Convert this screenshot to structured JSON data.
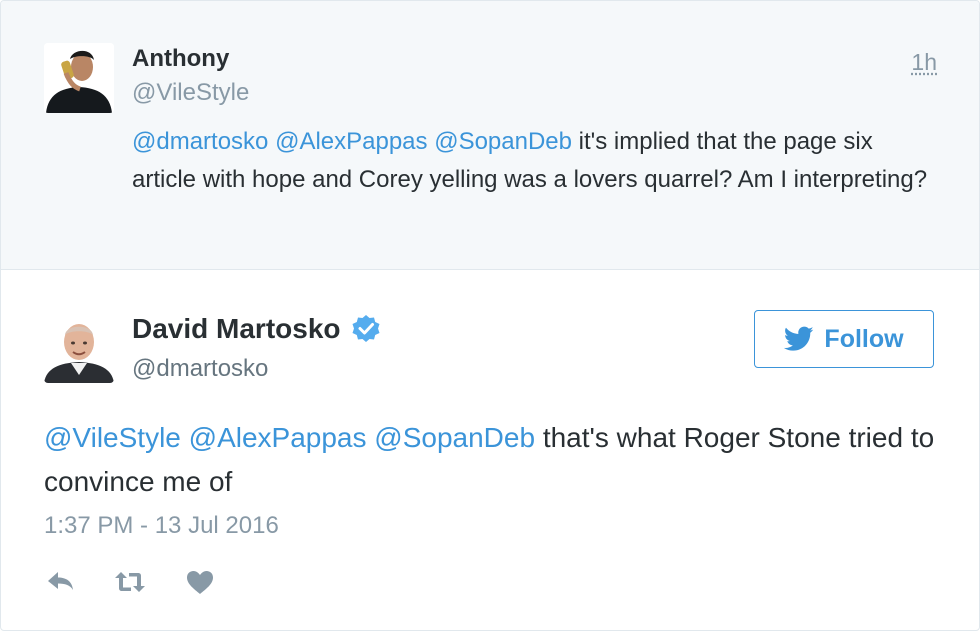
{
  "parent_tweet": {
    "author_name": "Anthony",
    "author_handle": "@VileStyle",
    "relative_time": "1h",
    "mentions": [
      "@dmartosko",
      "@AlexPappas",
      "@SopanDeb"
    ],
    "body_text": "it's implied that the page six article with hope and Corey yelling was a lovers quarrel? Am I interpreting?"
  },
  "tweet": {
    "author_name": "David Martosko",
    "author_handle": "@dmartosko",
    "verified": true,
    "follow_label": "Follow",
    "mentions": [
      "@VileStyle",
      "@AlexPappas",
      "@SopanDeb"
    ],
    "body_text": "that's what Roger Stone tried to convince me of",
    "timestamp": "1:37 PM - 13 Jul 2016",
    "actions": [
      "reply-icon",
      "retweet-icon",
      "like-icon"
    ]
  },
  "colors": {
    "accent": "#3b94d9",
    "text": "#292f33",
    "muted": "#8899a6",
    "parent_background": "#f5f8fa",
    "border": "#e1e8ed"
  }
}
